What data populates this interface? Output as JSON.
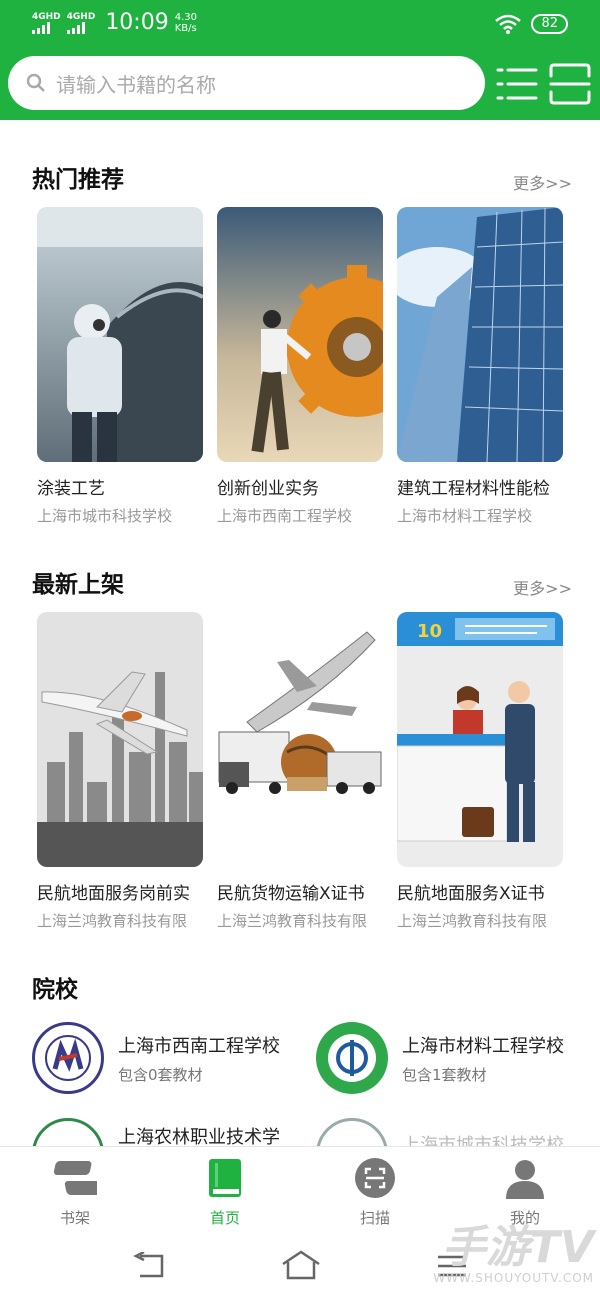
{
  "status": {
    "net1": "4GHD",
    "net2": "4GHD",
    "time": "10:09",
    "speed_value": "4.30",
    "speed_unit": "KB/s",
    "battery": "82"
  },
  "search": {
    "placeholder": "请输入书籍的名称"
  },
  "hot": {
    "title": "热门推荐",
    "more": "更多>>",
    "items": [
      {
        "title": "涂装工艺",
        "school": "上海市城市科技学校"
      },
      {
        "title": "创新创业实务",
        "school": "上海市西南工程学校"
      },
      {
        "title": "建筑工程材料性能检",
        "school": "上海市材料工程学校"
      }
    ]
  },
  "latest": {
    "title": "最新上架",
    "more": "更多>>",
    "items": [
      {
        "title": "民航地面服务岗前实",
        "school": "上海兰鸿教育科技有限"
      },
      {
        "title": "民航货物运输X证书",
        "school": "上海兰鸿教育科技有限"
      },
      {
        "title": "民航地面服务X证书",
        "school": "上海兰鸿教育科技有限"
      }
    ],
    "counter_number": "10"
  },
  "schools": {
    "title": "院校",
    "items": [
      {
        "name": "上海市西南工程学校",
        "count": "包含0套教材"
      },
      {
        "name": "上海市材料工程学校",
        "count": "包含1套教材"
      },
      {
        "name": "上海农林职业技术学",
        "count": ""
      },
      {
        "name": "上海市城市科技学校",
        "count": ""
      }
    ]
  },
  "nav": {
    "shelf": "书架",
    "home": "首页",
    "scan": "扫描",
    "mine": "我的"
  },
  "watermark": {
    "big": "手游TV",
    "small": "WWW.SHOUYOUTV.COM"
  },
  "colors": {
    "brand": "#1fb240",
    "muted": "#999999"
  }
}
